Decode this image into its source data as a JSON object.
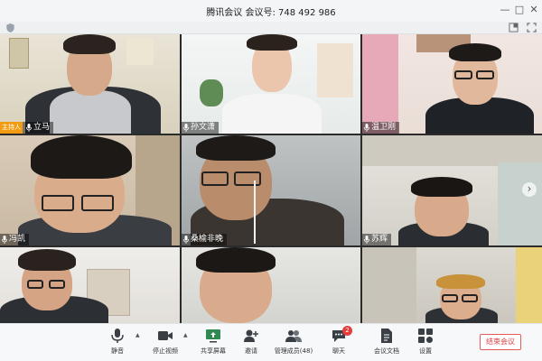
{
  "window": {
    "title": "腾讯会议 会议号: 748 492 986"
  },
  "participants": [
    {
      "name": "立马",
      "host_badge": "主持人"
    },
    {
      "name": "孙文潇"
    },
    {
      "name": "温卫刚"
    },
    {
      "name": "冯凯"
    },
    {
      "name": "桑榆非晚"
    },
    {
      "name": "苏辉"
    },
    {
      "name": ""
    },
    {
      "name": ""
    },
    {
      "name": ""
    }
  ],
  "toolbar": {
    "mute_label": "静音",
    "stop_video_label": "停止视频",
    "share_screen_label": "共享屏幕",
    "invite_label": "邀请",
    "members_label": "管理成员(48)",
    "chat_label": "聊天",
    "chat_badge": "2",
    "docs_label": "会议文档",
    "settings_label": "设置",
    "end_label": "结束会议"
  },
  "colors": {
    "end_button": "#e04040",
    "host_badge": "#f39c12",
    "chat_badge": "#e63b3b"
  }
}
